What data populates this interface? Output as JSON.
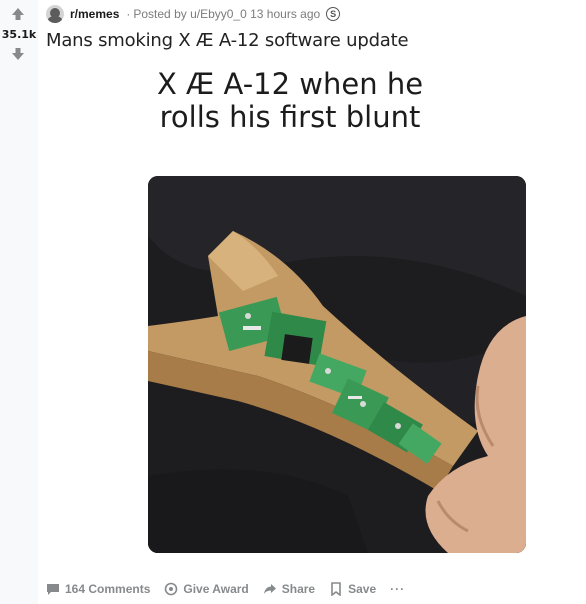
{
  "vote": {
    "count": "35.1k"
  },
  "post": {
    "subreddit": "r/memes",
    "separator": "·",
    "posted_by": "Posted by u/Ebyy0_0 13 hours ago",
    "award_icon_text": "S",
    "title": "Mans smoking X Æ A-12 software update"
  },
  "meme": {
    "caption_line1": "X Æ A-12 when he",
    "caption_line2": "rolls his first blunt"
  },
  "footer": {
    "comments": "164 Comments",
    "give_award": "Give Award",
    "share": "Share",
    "save": "Save",
    "more": "···"
  },
  "icons": {
    "upvote": "upvote-arrow-icon",
    "downvote": "downvote-arrow-icon",
    "comment": "comment-icon",
    "award": "award-icon",
    "share": "share-icon",
    "save": "bookmark-icon"
  },
  "colors": {
    "vote_bg": "#f8f9fa",
    "meta_text": "#7c7c7c",
    "footer_text": "#878a8c"
  }
}
